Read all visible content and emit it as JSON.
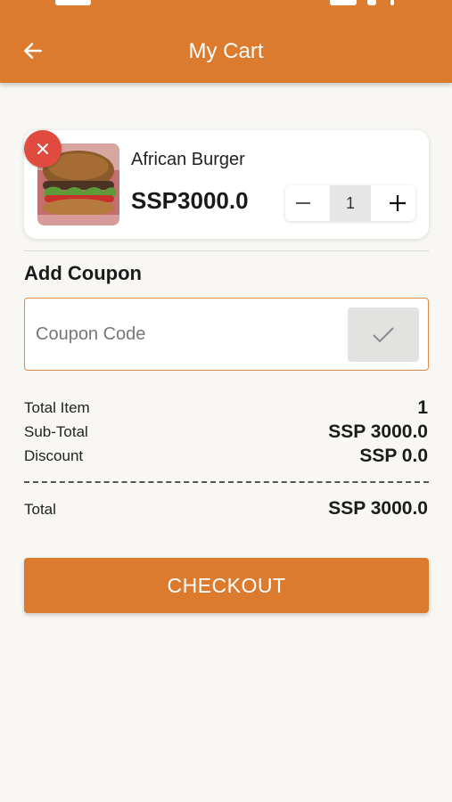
{
  "header": {
    "title": "My Cart",
    "back_icon": "arrow-left-icon",
    "background": "#dc7a2e"
  },
  "cart": {
    "items": [
      {
        "name": "African Burger",
        "price": "SSP3000.0",
        "quantity": "1",
        "thumbnail_icon": "burger-image"
      }
    ],
    "remove_icon": "close-icon",
    "minus_icon": "minus-icon",
    "plus_icon": "plus-icon"
  },
  "coupon": {
    "heading": "Add Coupon",
    "placeholder": "Coupon Code",
    "value": "",
    "apply_icon": "check-icon"
  },
  "summary": {
    "total_item_label": "Total Item",
    "total_item_value": "1",
    "subtotal_label": "Sub-Total",
    "subtotal_value": "SSP 3000.0",
    "discount_label": "Discount",
    "discount_value": "SSP 0.0",
    "total_label": "Total",
    "total_value": "SSP 3000.0"
  },
  "checkout": {
    "label": "CHECKOUT"
  },
  "colors": {
    "accent": "#dc7a2e",
    "remove": "#e04a3f",
    "background": "#f8f7f3"
  }
}
